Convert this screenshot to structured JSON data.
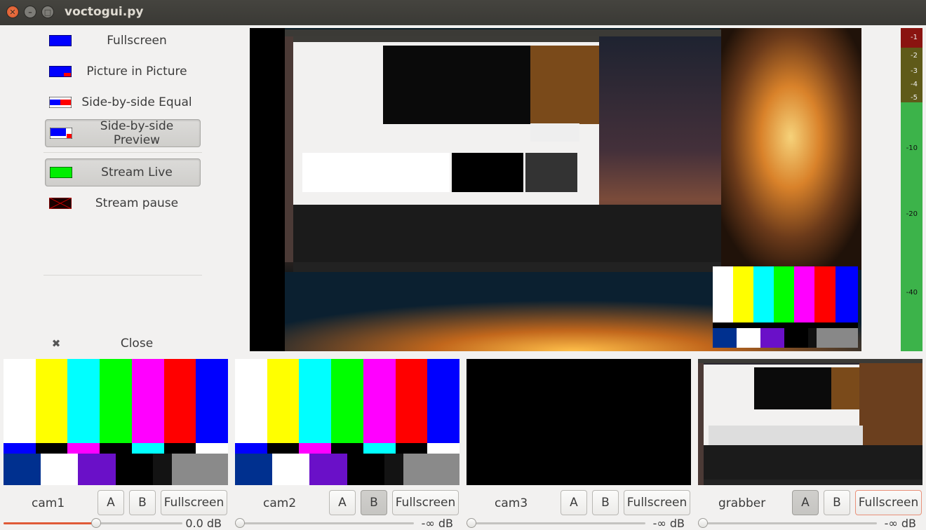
{
  "window": {
    "title": "voctogui.py"
  },
  "toolbar": {
    "items": [
      {
        "label": "Fullscreen",
        "icon": "composite-fullscreen-icon",
        "toggled": false
      },
      {
        "label": "Picture in Picture",
        "icon": "composite-pip-icon",
        "toggled": false
      },
      {
        "label": "Side-by-side Equal",
        "icon": "composite-sbs-equal-icon",
        "toggled": false
      },
      {
        "label": "Side-by-side Preview",
        "icon": "composite-sbs-preview-icon",
        "toggled": true
      },
      {
        "label": "Stream Live",
        "icon": "stream-live-icon",
        "toggled": true
      },
      {
        "label": "Stream pause",
        "icon": "stream-pause-icon",
        "toggled": false
      }
    ],
    "close_label": "Close",
    "close_icon": "close-icon"
  },
  "meter": {
    "scale": [
      "-1",
      "-2",
      "-3",
      "-4",
      "-5",
      "-10",
      "-20",
      "-40"
    ]
  },
  "sources": [
    {
      "name": "cam1",
      "a": "A",
      "b": "B",
      "fullscreen": "Fullscreen",
      "a_active": false,
      "b_active": false,
      "volume_label": "0.0 dB",
      "volume_level": 0.52
    },
    {
      "name": "cam2",
      "a": "A",
      "b": "B",
      "fullscreen": "Fullscreen",
      "a_active": false,
      "b_active": true,
      "volume_label": "-∞ dB",
      "volume_level": 0.0
    },
    {
      "name": "cam3",
      "a": "A",
      "b": "B",
      "fullscreen": "Fullscreen",
      "a_active": false,
      "b_active": false,
      "volume_label": "-∞ dB",
      "volume_level": 0.0
    },
    {
      "name": "grabber",
      "a": "A",
      "b": "B",
      "fullscreen": "Fullscreen",
      "a_active": true,
      "b_active": false,
      "volume_label": "-∞ dB",
      "volume_level": 0.0
    }
  ],
  "colors": {
    "accent": "#e05a37",
    "meter_green": "#3cb34a",
    "meter_red": "#8a1410"
  }
}
